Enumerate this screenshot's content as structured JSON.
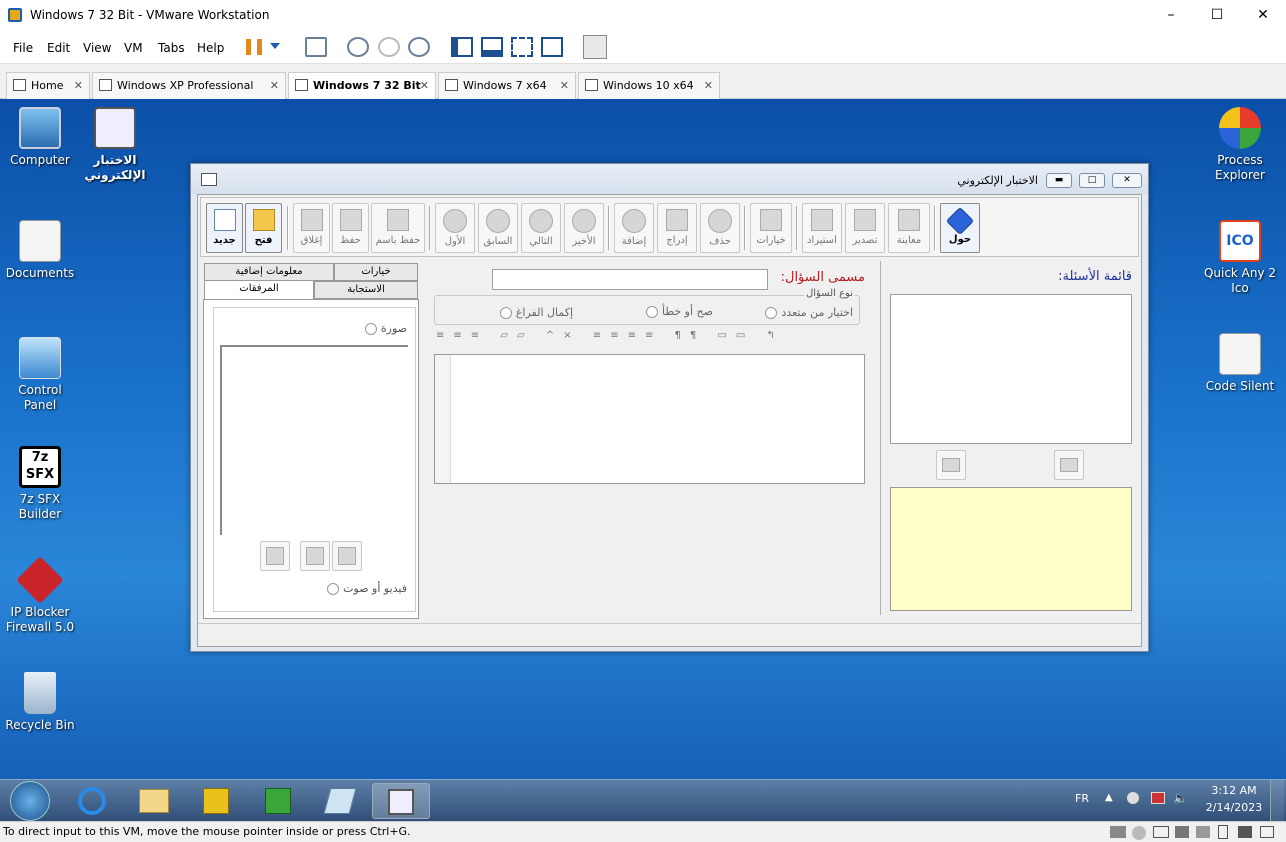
{
  "vmware": {
    "title": "Windows 7 32 Bit - VMware Workstation",
    "menu": [
      "File",
      "Edit",
      "View",
      "VM",
      "Tabs",
      "Help"
    ],
    "tabs": [
      {
        "label": "Home"
      },
      {
        "label": "Windows XP Professional"
      },
      {
        "label": "Windows 7 32 Bit",
        "active": true
      },
      {
        "label": "Windows 7 x64"
      },
      {
        "label": "Windows 10 x64"
      }
    ],
    "status": "To direct input to this VM, move the mouse pointer inside or press Ctrl+G."
  },
  "desktop": {
    "left_icons": [
      {
        "label": "Computer",
        "icon": "computer-icon"
      },
      {
        "label": "الاختبار الإلكتروني",
        "icon": "exam-app-icon"
      },
      {
        "label": "Documents",
        "icon": "documents-icon"
      },
      {
        "label": "Control Panel",
        "icon": "control-panel-icon"
      },
      {
        "label": "7z SFX Builder",
        "icon": "7z-icon"
      },
      {
        "label": "IP Blocker Firewall 5.0",
        "icon": "firewall-icon"
      },
      {
        "label": "Recycle Bin",
        "icon": "recycle-bin-icon"
      }
    ],
    "right_icons": [
      {
        "label": "Process Explorer",
        "icon": "process-explorer-icon"
      },
      {
        "label": "Quick Any 2 Ico",
        "icon": "ico-icon"
      },
      {
        "label": "Code Silent",
        "icon": "code-silent-icon"
      }
    ]
  },
  "app": {
    "title": "الاختبار الإلكتروني",
    "toolbar": {
      "about": "حول",
      "preview": "معاينة",
      "export": "تصدير",
      "import": "استيراد",
      "options": "خيارات",
      "delete": "حذف",
      "insert": "إدراج",
      "add": "إضافة",
      "last": "الأخير",
      "next": "التالي",
      "previous": "السابق",
      "first": "الأول",
      "save_as": "حفظ باسم",
      "save": "حفظ",
      "close": "إغلاق",
      "open": "فتح",
      "new": "جديد"
    },
    "questions_list_label": "قائمة الأسئلة:",
    "question_name_label": "مسمى السؤال:",
    "question_name_value": "",
    "question_type_label": "نوع السؤال",
    "question_types": [
      "اختيار من متعدد",
      "صح أو خطأ",
      "إكمال الفراغ"
    ],
    "right_tabs": {
      "row1": [
        "خيارات",
        "معلومات إضافية"
      ],
      "row2": [
        "الاستجابة",
        "المرفقات"
      ]
    },
    "attachments": {
      "image_label": "صورة",
      "video_label": "فيديو أو صوت"
    }
  },
  "taskbar": {
    "lang": "FR",
    "time": "3:12 AM",
    "date": "2/14/2023"
  }
}
